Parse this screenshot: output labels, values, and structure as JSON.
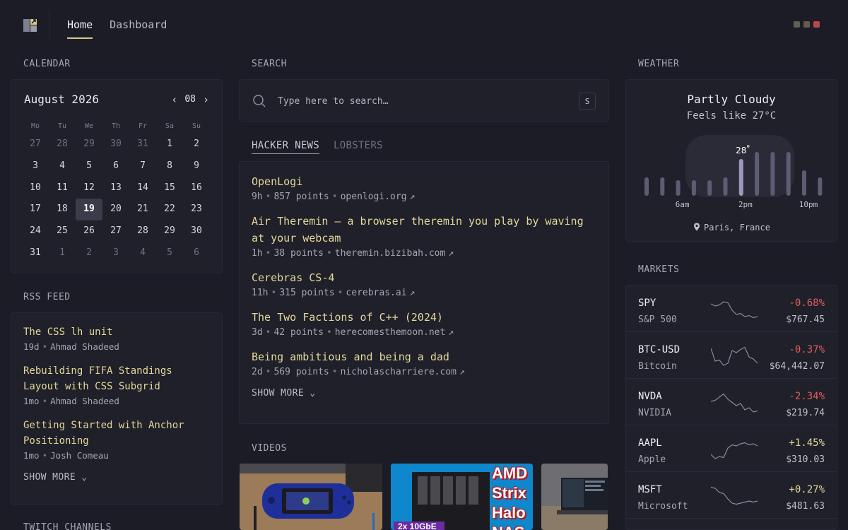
{
  "nav": {
    "home": "Home",
    "dashboard": "Dashboard",
    "dots": [
      "#5e6150",
      "#6b5a4a",
      "#b54a4a"
    ]
  },
  "calendar": {
    "section": "CALENDAR",
    "month": "August 2026",
    "month_num": "08",
    "weekdays": [
      "Mo",
      "Tu",
      "We",
      "Th",
      "Fr",
      "Sa",
      "Su"
    ],
    "days": [
      "27",
      "28",
      "29",
      "30",
      "31",
      "1",
      "2",
      "3",
      "4",
      "5",
      "6",
      "7",
      "8",
      "9",
      "10",
      "11",
      "12",
      "13",
      "14",
      "15",
      "16",
      "17",
      "18",
      "19",
      "20",
      "21",
      "22",
      "23",
      "24",
      "25",
      "26",
      "27",
      "28",
      "29",
      "30",
      "31",
      "1",
      "2",
      "3",
      "4",
      "5",
      "6"
    ],
    "today": "19"
  },
  "rss": {
    "section": "RSS FEED",
    "items": [
      {
        "title": "The CSS lh unit",
        "age": "19d",
        "author": "Ahmad Shadeed"
      },
      {
        "title": "Rebuilding FIFA Standings Layout with CSS Subgrid",
        "age": "1mo",
        "author": "Ahmad Shadeed"
      },
      {
        "title": "Getting Started with Anchor Positioning",
        "age": "1mo",
        "author": "Josh Comeau"
      }
    ],
    "show_more": "SHOW MORE"
  },
  "twitch": {
    "section": "TWITCH CHANNELS"
  },
  "search": {
    "section": "SEARCH",
    "placeholder": "Type here to search…",
    "shortcut": "S"
  },
  "news": {
    "tabs": [
      "HACKER NEWS",
      "LOBSTERS"
    ],
    "items": [
      {
        "title": "OpenLogi",
        "age": "9h",
        "points": "857 points",
        "domain": "openlogi.org"
      },
      {
        "title": "Air Theremin – a browser theremin you play by waving at your webcam",
        "age": "1h",
        "points": "38 points",
        "domain": "theremin.bizibah.com"
      },
      {
        "title": "Cerebras CS-4",
        "age": "11h",
        "points": "315 points",
        "domain": "cerebras.ai"
      },
      {
        "title": "The Two Factions of C++ (2024)",
        "age": "3d",
        "points": "42 points",
        "domain": "herecomesthemoon.net"
      },
      {
        "title": "Being ambitious and being a dad",
        "age": "2d",
        "points": "569 points",
        "domain": "nicholascharriere.com"
      }
    ],
    "show_more": "SHOW MORE"
  },
  "videos": {
    "section": "VIDEOS",
    "thumb2_text": [
      "AMD",
      "Strix",
      "Halo",
      "NAS"
    ],
    "thumb2_badge": "2x 10GbE"
  },
  "weather": {
    "section": "WEATHER",
    "condition": "Partly Cloudy",
    "feels": "Feels like 27°C",
    "current_temp": "28",
    "times": [
      "6am",
      "2pm",
      "10pm"
    ],
    "location": "Paris, France",
    "bar_levels": [
      0.26,
      0.26,
      0.22,
      0.22,
      0.22,
      0.26,
      0.52,
      0.62,
      0.62,
      0.62,
      0.36,
      0.26
    ]
  },
  "markets": {
    "section": "MARKETS",
    "items": [
      {
        "symbol": "SPY",
        "name": "S&P 500",
        "change": "-0.68%",
        "price": "$767.45",
        "dir": "neg",
        "spark": [
          0.8,
          0.7,
          0.75,
          0.9,
          0.85,
          0.5,
          0.3,
          0.35,
          0.2,
          0.25,
          0.15,
          0.2
        ]
      },
      {
        "symbol": "BTC-USD",
        "name": "Bitcoin",
        "change": "-0.37%",
        "price": "$64,442.07",
        "dir": "neg",
        "spark": [
          0.9,
          0.3,
          0.35,
          0.1,
          0.2,
          0.8,
          0.7,
          0.85,
          0.95,
          0.5,
          0.4,
          0.2
        ]
      },
      {
        "symbol": "NVDA",
        "name": "NVIDIA",
        "change": "-2.34%",
        "price": "$219.74",
        "dir": "neg",
        "spark": [
          0.6,
          0.65,
          0.8,
          0.95,
          0.7,
          0.55,
          0.4,
          0.5,
          0.2,
          0.3,
          0.1,
          0.15
        ]
      },
      {
        "symbol": "AAPL",
        "name": "Apple",
        "change": "+1.45%",
        "price": "$310.03",
        "dir": "pos",
        "spark": [
          0.3,
          0.1,
          0.2,
          0.15,
          0.6,
          0.75,
          0.7,
          0.8,
          0.85,
          0.75,
          0.8,
          0.7
        ]
      },
      {
        "symbol": "MSFT",
        "name": "Microsoft",
        "change": "+0.27%",
        "price": "$481.63",
        "dir": "pos",
        "spark": [
          0.95,
          0.9,
          0.7,
          0.65,
          0.4,
          0.2,
          0.15,
          0.2,
          0.25,
          0.3,
          0.25,
          0.3
        ]
      }
    ]
  }
}
